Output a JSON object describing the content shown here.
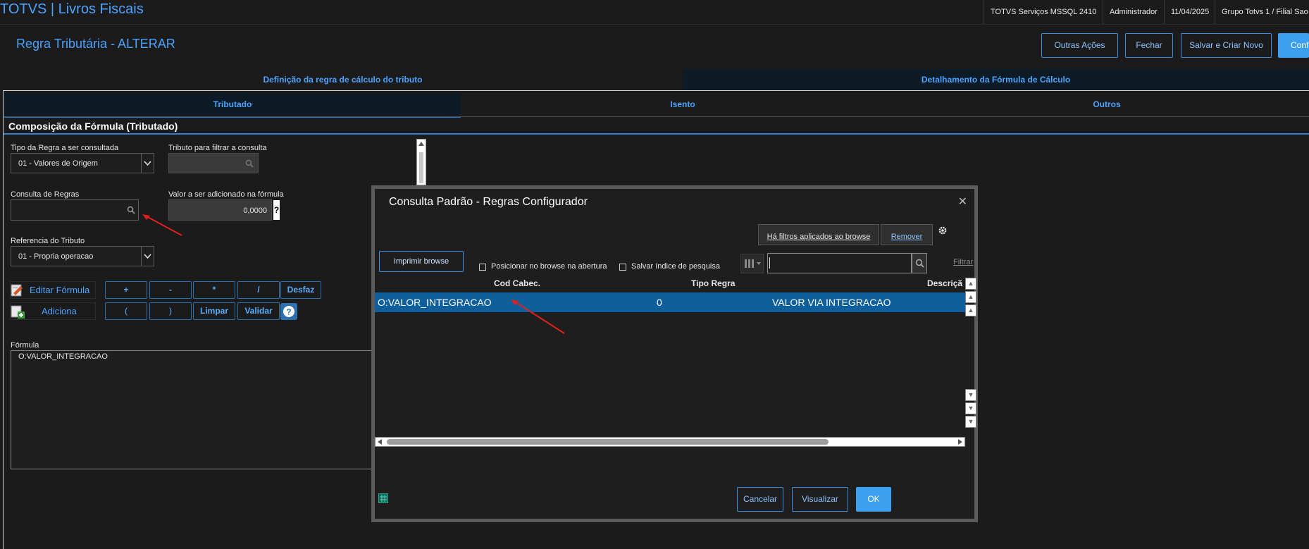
{
  "header": {
    "app_title": "TOTVS | Livros Fiscais",
    "environment": "TOTVS Serviços MSSQL 2410",
    "user": "Administrador",
    "date": "11/04/2025",
    "branch": "Grupo Totvs 1 / Filial Sao"
  },
  "page": {
    "title": "Regra Tributária - ALTERAR",
    "buttons": {
      "more_actions": "Outras Ações",
      "close": "Fechar",
      "save_new": "Salvar e Criar Novo",
      "confirm": "Confi"
    }
  },
  "tabs": {
    "definition": "Definição da regra de cálculo do tributo",
    "detail": "Detalhamento da Fórmula de Cálculo"
  },
  "subtabs": {
    "taxed": "Tributado",
    "exempt": "Isento",
    "others": "Outros"
  },
  "form": {
    "section_title": "Composição da Fórmula (Tributado)",
    "rule_type_label": "Tipo da Regra a ser consultada",
    "rule_type_value": "01 - Valores de Origem",
    "tax_filter_label": "Tributo para filtrar a consulta",
    "rule_query_label": "Consulta de Regras",
    "added_value_label": "Valor a ser adicionado na fórmula",
    "added_value": "0,0000",
    "help_mark": "?",
    "tax_reference_label": "Referencia do Tributo",
    "tax_reference_value": "01 - Propria operacao",
    "edit_formula": "Editar Fórmula",
    "add": "Adiciona",
    "operators": {
      "plus": "+",
      "minus": "-",
      "times": "*",
      "divide": "/",
      "undo": "Desfaz",
      "open_paren": "(",
      "close_paren": ")",
      "clear": "Limpar",
      "validate": "Validar"
    },
    "formula_label": "Fórmula",
    "formula_value": "O:VALOR_INTEGRACAO"
  },
  "modal": {
    "title": "Consulta Padrão - Regras Configurador",
    "filters_applied": "Há filtros aplicados ao browse",
    "remove": "Remover",
    "print_browse": "Imprimir browse",
    "position_on_open": "Posicionar no browse na abertura",
    "save_search_index": "Salvar índice de pesquisa",
    "filter_link": "Filtrar",
    "search_value": "",
    "columns": [
      "Cod Cabec.",
      "Tipo Regra",
      "Descriçã"
    ],
    "rows": [
      {
        "code": "O:VALOR_INTEGRACAO",
        "type": "0",
        "description": "VALOR VIA INTEGRACAO"
      }
    ],
    "buttons": {
      "cancel": "Cancelar",
      "view": "Visualizar",
      "ok": "OK"
    }
  },
  "colors": {
    "accent": "#4aa3ff",
    "primary_button": "#3c9ff0",
    "selected_row": "#0f5f9c",
    "annotation_arrow": "#e0201b"
  }
}
